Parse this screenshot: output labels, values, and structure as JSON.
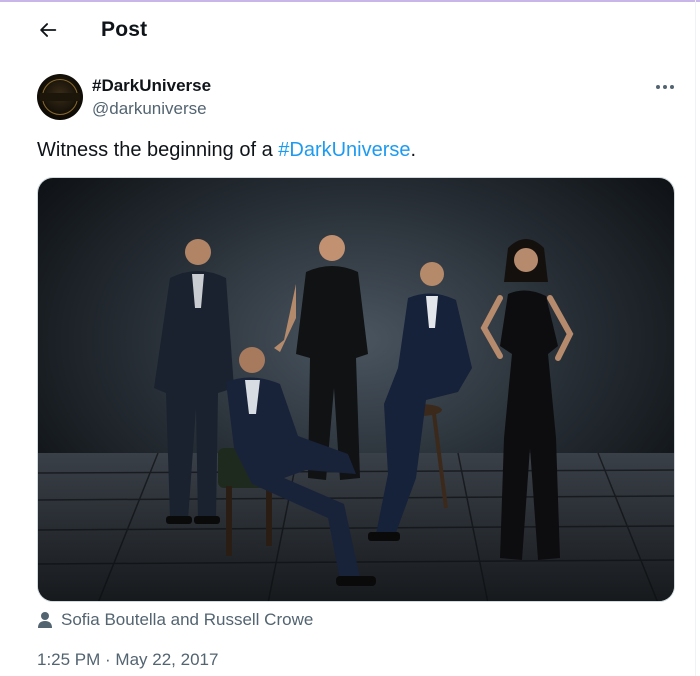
{
  "header": {
    "title": "Post"
  },
  "account": {
    "display_name": "#DarkUniverse",
    "handle": "@darkuniverse"
  },
  "tweet": {
    "text_before": "Witness the beginning of a ",
    "hashtag": "#DarkUniverse",
    "text_after": "."
  },
  "media": {
    "tagged_people": "Sofia Boutella and Russell Crowe"
  },
  "meta": {
    "timestamp": "1:25 PM · May 22, 2017"
  },
  "colors": {
    "link": "#1d9bf0",
    "secondary_text": "#536471",
    "primary_text": "#0f1419",
    "border": "#cfd9de"
  },
  "icons": {
    "back": "arrow-left-icon",
    "more": "more-horizontal-icon",
    "tag": "person-icon"
  }
}
